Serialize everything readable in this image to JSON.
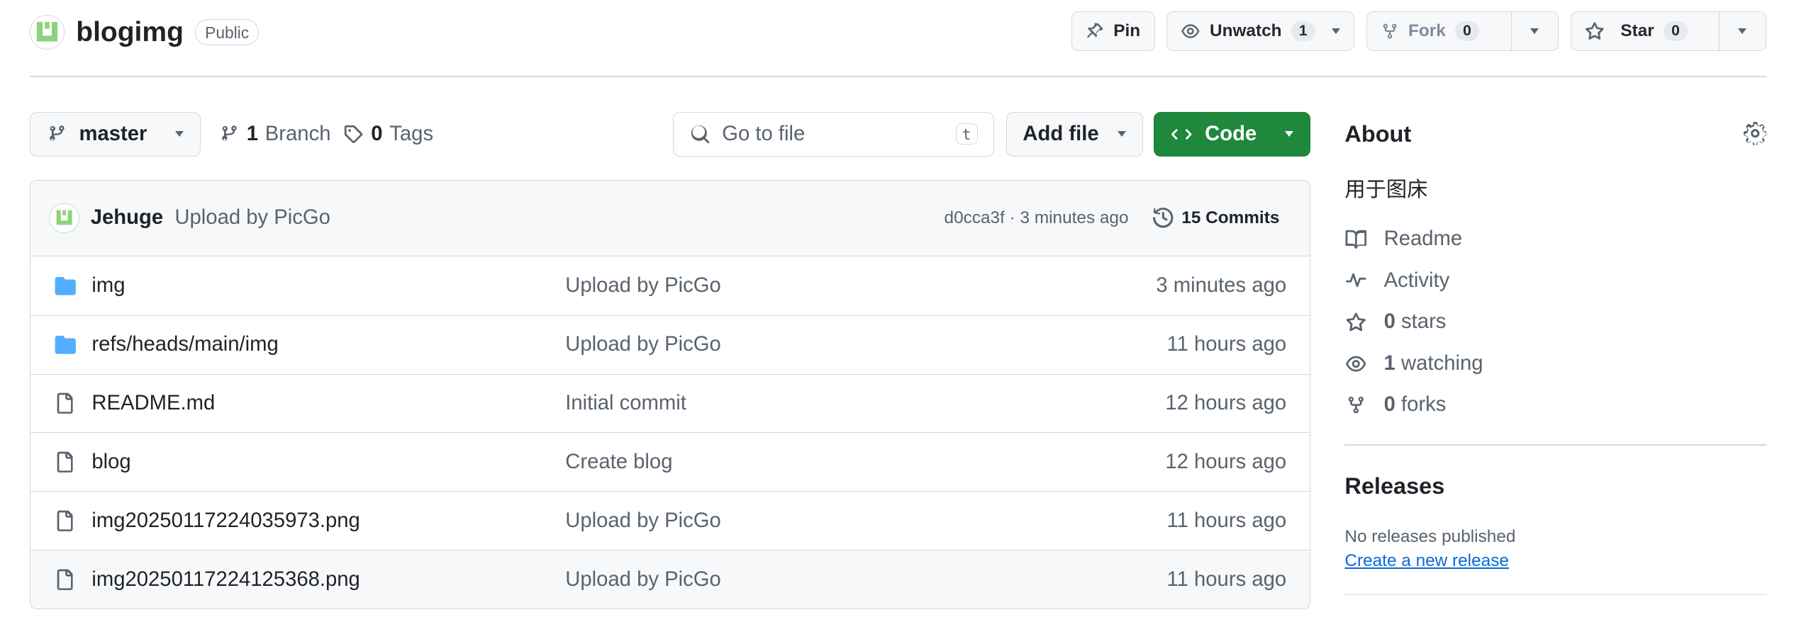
{
  "repo": {
    "name": "blogimg",
    "visibility": "Public"
  },
  "header_actions": {
    "pin": "Pin",
    "unwatch": "Unwatch",
    "watch_count": "1",
    "fork": "Fork",
    "fork_count": "0",
    "star": "Star",
    "star_count": "0"
  },
  "toolbar": {
    "branch": "master",
    "branches_count": "1",
    "branches_label": "Branch",
    "tags_count": "0",
    "tags_label": "Tags",
    "goto_placeholder": "Go to file",
    "goto_kbd": "t",
    "add_file": "Add file",
    "code": "Code"
  },
  "latest_commit": {
    "author": "Jehuge",
    "message": "Upload by PicGo",
    "hash_time": "d0cca3f · 3 minutes ago",
    "commits": "15 Commits"
  },
  "files": [
    {
      "type": "folder",
      "name": "img",
      "message": "Upload by PicGo",
      "time": "3 minutes ago"
    },
    {
      "type": "folder",
      "name": "refs/heads/main/img",
      "message": "Upload by PicGo",
      "time": "11 hours ago"
    },
    {
      "type": "file",
      "name": "README.md",
      "message": "Initial commit",
      "time": "12 hours ago"
    },
    {
      "type": "file",
      "name": "blog",
      "message": "Create blog",
      "time": "12 hours ago"
    },
    {
      "type": "file",
      "name": "img20250117224035973.png",
      "message": "Upload by PicGo",
      "time": "11 hours ago"
    },
    {
      "type": "file",
      "name": "img20250117224125368.png",
      "message": "Upload by PicGo",
      "time": "11 hours ago"
    }
  ],
  "about": {
    "title": "About",
    "description": "用于图床",
    "readme": "Readme",
    "activity": "Activity",
    "stars_count": "0",
    "stars_label": "stars",
    "watching_count": "1",
    "watching_label": "watching",
    "forks_count": "0",
    "forks_label": "forks"
  },
  "releases": {
    "title": "Releases",
    "none": "No releases published",
    "create_link": "Create a new release"
  },
  "colors": {
    "accent": "#1f883d",
    "link": "#0969da",
    "border": "#d1d9e0",
    "muted": "#59636e",
    "folder": "#54aeff"
  }
}
